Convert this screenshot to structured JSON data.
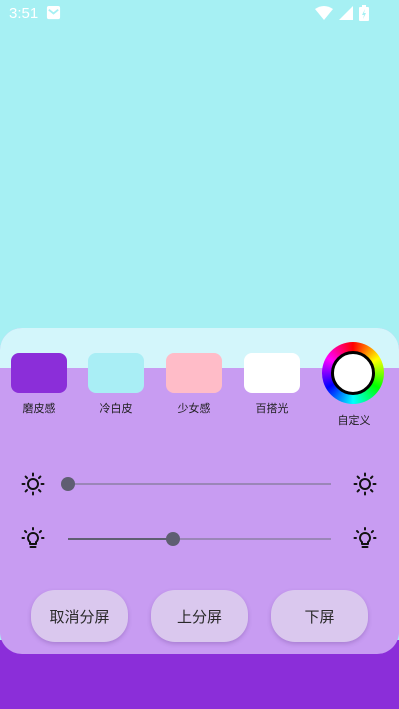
{
  "status_bar": {
    "time": "3:51"
  },
  "colors": {
    "page_background": "#a6f0f3",
    "panel_background": "#c89cf2",
    "panel_top_strip": "#d3f6fb",
    "bottom_strip": "#8b2ed9",
    "button_background": "#dac8ee"
  },
  "filters": [
    {
      "label": "磨皮感",
      "color": "#8b2ed9"
    },
    {
      "label": "冷白皮",
      "color": "#a9eef5"
    },
    {
      "label": "少女感",
      "color": "#ffbcc8"
    },
    {
      "label": "百搭光",
      "color": "#ffffff"
    }
  ],
  "custom": {
    "label": "自定义"
  },
  "sliders": {
    "brightness": {
      "value_percent": 0,
      "left_icon": "sun-icon",
      "right_icon": "sun-icon"
    },
    "light": {
      "value_percent": 40,
      "left_icon": "bulb-icon",
      "right_icon": "bulb-icon"
    }
  },
  "buttons": {
    "cancel_split": "取消分屏",
    "upper_split": "上分屏",
    "lower_screen": "下屏"
  }
}
